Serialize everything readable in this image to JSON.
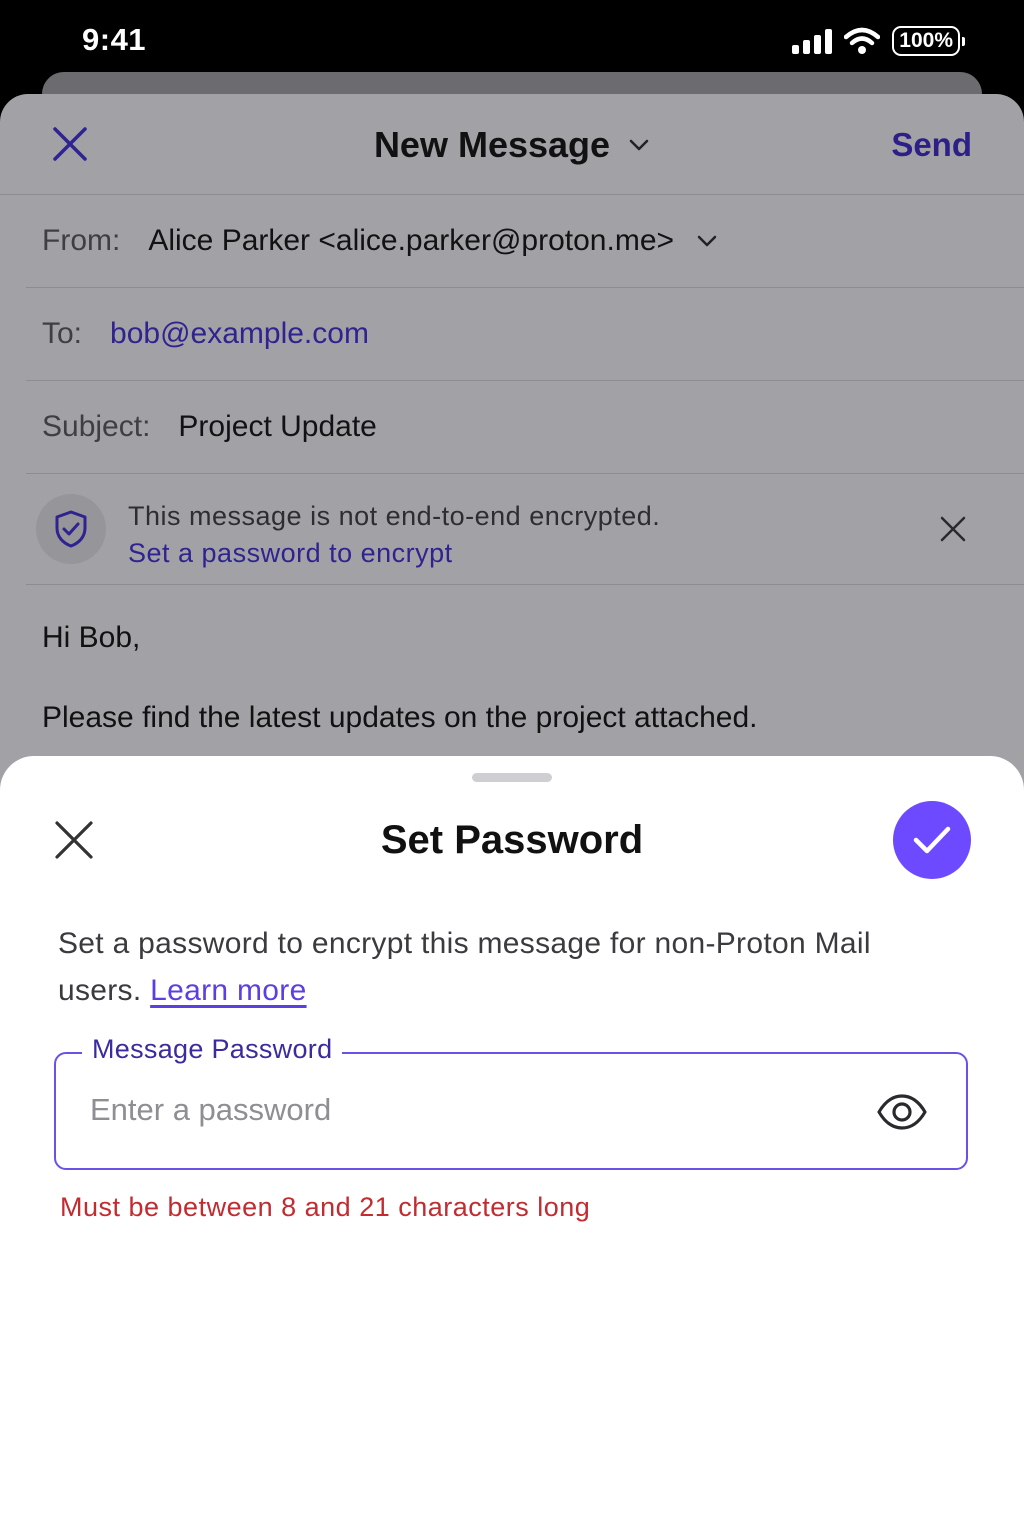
{
  "status_bar": {
    "time": "9:41",
    "battery": "100%"
  },
  "compose": {
    "title": "New Message",
    "send_label": "Send",
    "from": {
      "label": "From:",
      "value": "Alice Parker <alice.parker@proton.me>"
    },
    "to": {
      "label": "To:",
      "value": "bob@example.com"
    },
    "subject": {
      "label": "Subject:",
      "value": "Project Update"
    },
    "encryption_notice": {
      "message": "This message is not end-to-end encrypted.",
      "link": "Set a password to encrypt"
    },
    "body": {
      "greeting": "Hi Bob,",
      "paragraph": "Please find the latest updates on the project attached."
    }
  },
  "sheet": {
    "title": "Set Password",
    "description": "Set a password to encrypt this message for non-Proton Mail users.",
    "learn_more": "Learn more",
    "password_field": {
      "label": "Message Password",
      "placeholder": "Enter a password",
      "value": ""
    },
    "error": "Must be between 8 and 21 characters long"
  },
  "colors": {
    "accent": "#6d4aff",
    "link_dimmed": "#2f2390",
    "error": "#c22b30"
  },
  "icons": [
    "close-icon",
    "chevron-down-icon",
    "shield-check-icon",
    "checkmark-icon",
    "eye-icon",
    "signal-icon",
    "wifi-icon",
    "battery-icon"
  ]
}
